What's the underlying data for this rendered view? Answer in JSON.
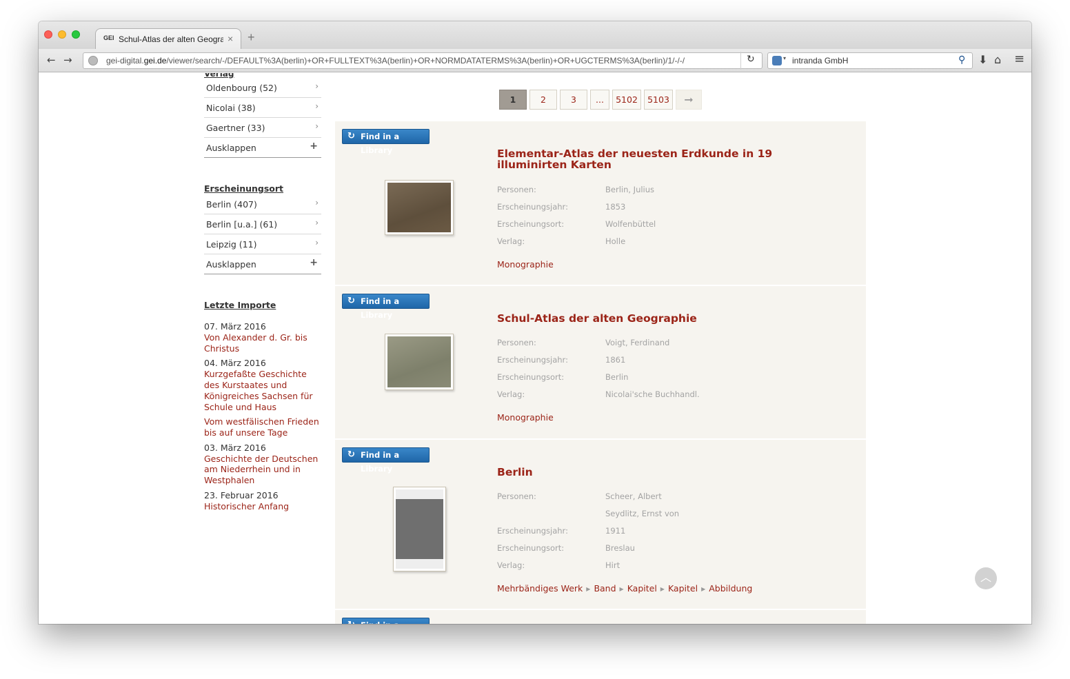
{
  "browser": {
    "tab_favicon": "GEI",
    "tab_title": "Schul-Atlas der alten Geograp...",
    "tab_close": "×",
    "new_tab": "+",
    "url_prefix": "gei-digital.",
    "url_domain": "gei.de",
    "url_path": "/viewer/search/-/DEFAULT%3A(berlin)+OR+FULLTEXT%3A(berlin)+OR+NORMDATATERMS%3A(berlin)+OR+UGCTERMS%3A(berlin)/1/-/-/",
    "search_engine": "intranda GmbH",
    "icons": {
      "back": "←",
      "forward": "→",
      "reload": "↻",
      "search": "⚲",
      "download": "⬇",
      "home": "⌂",
      "menu": "≡"
    }
  },
  "sidebar": {
    "heading_verlag": "Verlag",
    "verlag": [
      {
        "label": "Oldenbourg (52)"
      },
      {
        "label": "Nicolai (38)"
      },
      {
        "label": "Gaertner (33)"
      }
    ],
    "expand_label": "Ausklappen",
    "chevron": "›",
    "plus": "+",
    "heading_ort": "Erscheinungsort",
    "ort": [
      {
        "label": "Berlin (407)"
      },
      {
        "label": "Berlin [u.a.] (61)"
      },
      {
        "label": "Leipzig (11)"
      }
    ],
    "heading_imports": "Letzte Importe",
    "imports": {
      "d1": "07. März 2016",
      "l1": "Von Alexander d. Gr. bis Christus",
      "d2": "04. März 2016",
      "l2": "Kurzgefaßte Geschichte des Kurstaates und Königreiches Sachsen für Schule und Haus",
      "l3": "Vom westfälischen Frieden bis auf unsere Tage",
      "d3": "03. März 2016",
      "l4": "Geschichte der Deutschen am Niederrhein und in Westphalen",
      "d4": "23. Februar 2016",
      "l5": "Historischer Anfang"
    }
  },
  "pagination": {
    "p1": "1",
    "p2": "2",
    "p3": "3",
    "ellipsis": "...",
    "p4": "5102",
    "p5": "5103",
    "next": "➞"
  },
  "find_button": "Find in a Library",
  "find_icon": "↻",
  "labels": {
    "personen": "Personen:",
    "jahr": "Erscheinungsjahr:",
    "ort": "Erscheinungsort:",
    "verlag": "Verlag:"
  },
  "results": [
    {
      "title": "Elementar-Atlas der neuesten Erdkunde in 19 illuminirten Karten",
      "personen": "Berlin, Julius",
      "jahr": "1853",
      "ort": "Wolfenbüttel",
      "verlag": "Holle",
      "type": "Monographie"
    },
    {
      "title": "Schul-Atlas der alten Geographie",
      "personen": "Voigt, Ferdinand",
      "jahr": "1861",
      "ort": "Berlin",
      "verlag": "Nicolai'sche Buchhandl.",
      "type": "Monographie"
    },
    {
      "title": "Berlin",
      "personen": "Scheer, Albert",
      "personen2": "Seydlitz, Ernst von",
      "jahr": "1911",
      "ort": "Breslau",
      "verlag": "Hirt",
      "crumbs": [
        "Mehrbändiges Werk",
        "Band",
        "Kapitel",
        "Kapitel",
        "Abbildung"
      ]
    }
  ],
  "scroll_top_icon": "︿",
  "colors": {
    "accent": "#9b2418",
    "button_blue": "#2a76b9",
    "result_bg": "#f6f4ef"
  }
}
